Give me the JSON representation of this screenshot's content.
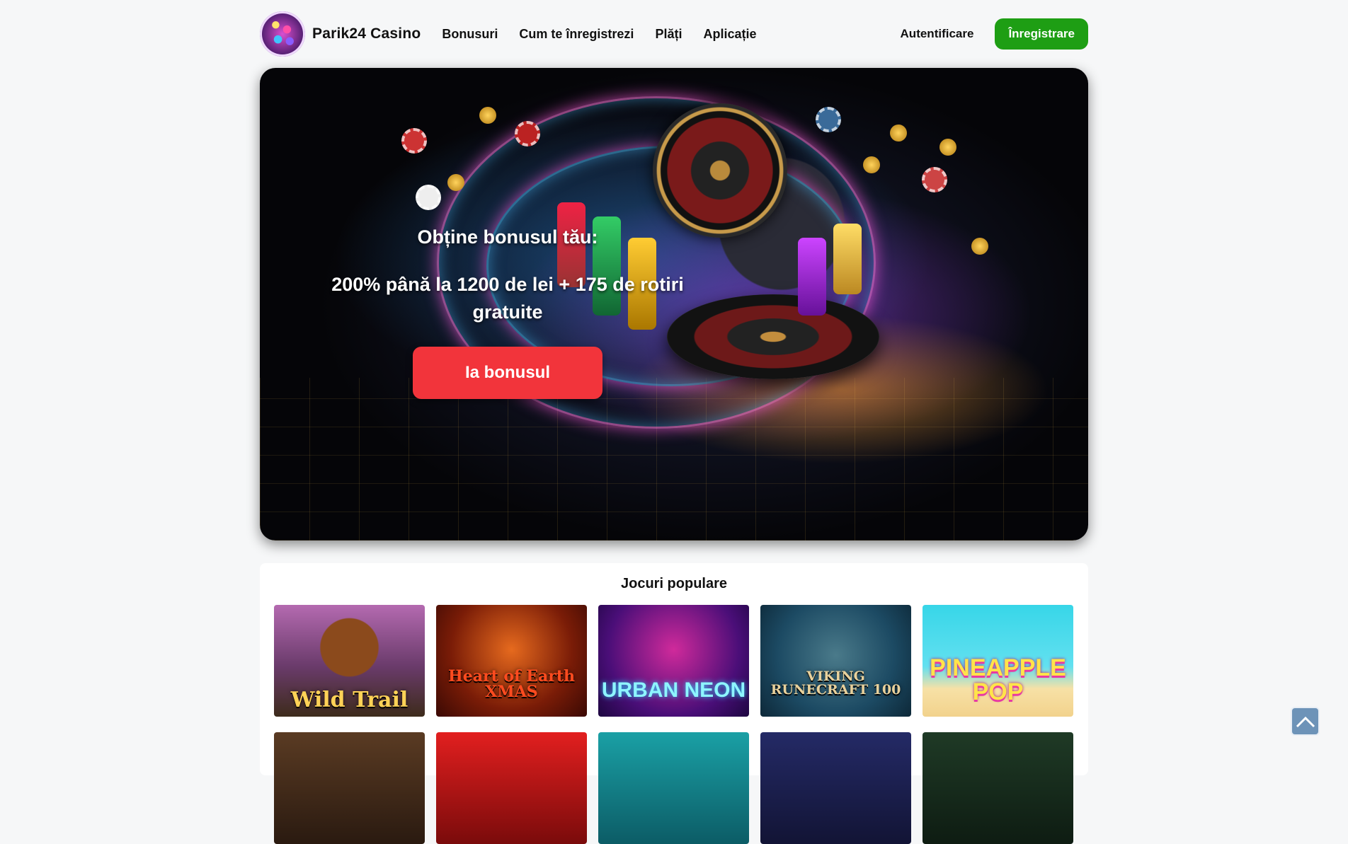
{
  "header": {
    "brand": "Parik24 Casino",
    "nav": [
      "Bonusuri",
      "Cum te înregistrezi",
      "Plăți",
      "Aplicație"
    ],
    "login_label": "Autentificare",
    "register_label": "Înregistrare"
  },
  "hero": {
    "title": "Obține bonusul tău:",
    "offer": "200% până la 1200 de lei + 175 de rotiri gratuite",
    "cta_label": "Ia bonusul"
  },
  "games": {
    "title": "Jocuri populare",
    "items": [
      {
        "name": "Wild Trail"
      },
      {
        "name": "Heart of Earth XMAS"
      },
      {
        "name": "URBAN NEON"
      },
      {
        "name": "VIKING RUNECRAFT 100"
      },
      {
        "name": "PINEAPPLE POP"
      },
      {
        "name": ""
      },
      {
        "name": ""
      },
      {
        "name": ""
      },
      {
        "name": ""
      },
      {
        "name": ""
      }
    ]
  },
  "colors": {
    "register": "#1e9e14",
    "cta": "#f2343b",
    "background": "#f6f7f8"
  },
  "icons": {
    "scroll_top": "chevron-up-icon",
    "logo": "casino-logo-icon"
  }
}
